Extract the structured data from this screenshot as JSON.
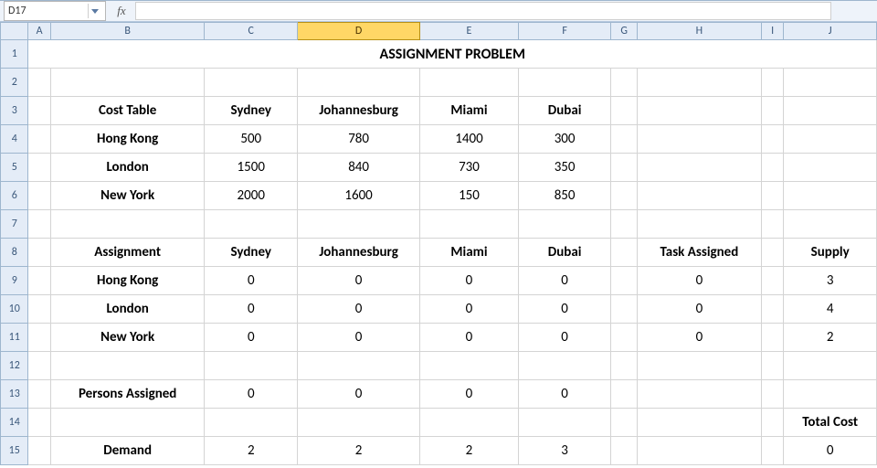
{
  "namebox": {
    "value": "D17"
  },
  "fx_label": "fx",
  "formula": "",
  "columns": [
    {
      "id": "A",
      "label": "A",
      "width": 24
    },
    {
      "id": "B",
      "label": "B",
      "width": 166
    },
    {
      "id": "C",
      "label": "C",
      "width": 100
    },
    {
      "id": "D",
      "label": "D",
      "width": 132,
      "selected": true
    },
    {
      "id": "E",
      "label": "E",
      "width": 106
    },
    {
      "id": "F",
      "label": "F",
      "width": 100
    },
    {
      "id": "G",
      "label": "G",
      "width": 28
    },
    {
      "id": "H",
      "label": "H",
      "width": 134
    },
    {
      "id": "I",
      "label": "I",
      "width": 24
    },
    {
      "id": "J",
      "label": "J",
      "width": 100
    }
  ],
  "row_count": 15,
  "title": {
    "row": 1,
    "colspan": "A:J",
    "text": "ASSIGNMENT PROBLEM"
  },
  "cells": {
    "B3": "Cost Table",
    "C3": "Sydney",
    "D3": "Johannesburg",
    "E3": "Miami",
    "F3": "Dubai",
    "B4": "Hong Kong",
    "C4": "500",
    "D4": "780",
    "E4": "1400",
    "F4": "300",
    "B5": "London",
    "C5": "1500",
    "D5": "840",
    "E5": "730",
    "F5": "350",
    "B6": "New York",
    "C6": "2000",
    "D6": "1600",
    "E6": "150",
    "F6": "850",
    "B8": "Assignment",
    "C8": "Sydney",
    "D8": "Johannesburg",
    "E8": "Miami",
    "F8": "Dubai",
    "H8": "Task Assigned",
    "J8": "Supply",
    "B9": "Hong Kong",
    "C9": "0",
    "D9": "0",
    "E9": "0",
    "F9": "0",
    "H9": "0",
    "J9": "3",
    "B10": "London",
    "C10": "0",
    "D10": "0",
    "E10": "0",
    "F10": "0",
    "H10": "0",
    "J10": "4",
    "B11": "New York",
    "C11": "0",
    "D11": "0",
    "E11": "0",
    "F11": "0",
    "H11": "0",
    "J11": "2",
    "B13": "Persons Assigned",
    "C13": "0",
    "D13": "0",
    "E13": "0",
    "F13": "0",
    "J14": "Total Cost",
    "B15": "Demand",
    "C15": "2",
    "D15": "2",
    "E15": "2",
    "F15": "3",
    "J15": "0"
  },
  "bold_cells": [
    "B3",
    "C3",
    "D3",
    "E3",
    "F3",
    "B4",
    "B5",
    "B6",
    "B8",
    "C8",
    "D8",
    "E8",
    "F8",
    "H8",
    "J8",
    "B9",
    "B10",
    "B11",
    "B13",
    "J14",
    "B15"
  ],
  "chart_data": {
    "type": "table",
    "title": "ASSIGNMENT PROBLEM",
    "cost_table": {
      "rows": [
        "Hong Kong",
        "London",
        "New York"
      ],
      "cols": [
        "Sydney",
        "Johannesburg",
        "Miami",
        "Dubai"
      ],
      "values": [
        [
          500,
          780,
          1400,
          300
        ],
        [
          1500,
          840,
          730,
          350
        ],
        [
          2000,
          1600,
          150,
          850
        ]
      ]
    },
    "assignment": {
      "rows": [
        "Hong Kong",
        "London",
        "New York"
      ],
      "cols": [
        "Sydney",
        "Johannesburg",
        "Miami",
        "Dubai"
      ],
      "values": [
        [
          0,
          0,
          0,
          0
        ],
        [
          0,
          0,
          0,
          0
        ],
        [
          0,
          0,
          0,
          0
        ]
      ],
      "task_assigned": [
        0,
        0,
        0
      ],
      "supply": [
        3,
        4,
        2
      ],
      "persons_assigned": [
        0,
        0,
        0,
        0
      ],
      "demand": [
        2,
        2,
        2,
        3
      ],
      "total_cost": 0
    }
  }
}
